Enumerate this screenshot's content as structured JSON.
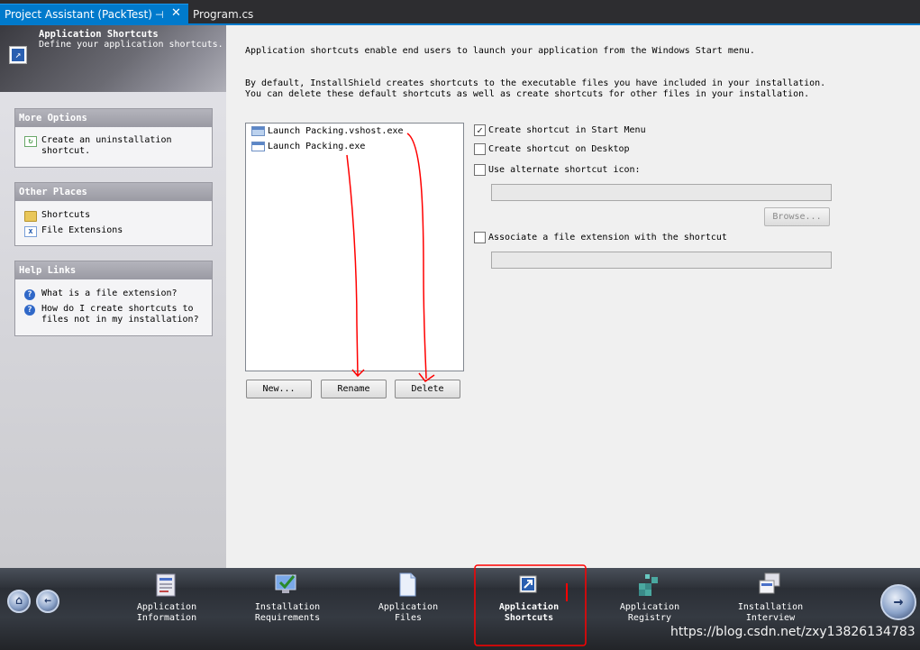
{
  "tabs": [
    {
      "label": "Project Assistant (PackTest)",
      "active": true,
      "pin_icon": "pin-icon",
      "close_icon": "close-icon"
    },
    {
      "label": "Program.cs",
      "active": false
    }
  ],
  "left_panel": {
    "title": "Application Shortcuts",
    "subtitle": "Define your application shortcuts.",
    "more_options": {
      "heading": "More Options",
      "items": [
        {
          "label_line1": "Create an uninstallation",
          "label_line2": "shortcut."
        }
      ]
    },
    "other_places": {
      "heading": "Other Places",
      "items": [
        {
          "label": "Shortcuts"
        },
        {
          "label": "File Extensions"
        }
      ]
    },
    "help_links": {
      "heading": "Help Links",
      "items": [
        {
          "label": "What is a file extension?"
        },
        {
          "label_line1": "How do I create shortcuts to",
          "label_line2": "files not in my installation?"
        }
      ]
    }
  },
  "main": {
    "description1": "Application shortcuts enable end users to launch your application from the Windows Start menu.",
    "description2": "By default, InstallShield creates shortcuts to the executable files you have included in your installation.",
    "description3": "You can delete these default shortcuts as well as create shortcuts for other files in your installation.",
    "shortcuts": [
      {
        "label": "Launch Packing.vshost.exe",
        "selected": true
      },
      {
        "label": "Launch Packing.exe",
        "selected": false
      }
    ],
    "buttons": {
      "new": "New...",
      "rename": "Rename",
      "delete": "Delete",
      "browse": "Browse..."
    },
    "options": {
      "start_menu": {
        "label": "Create shortcut in Start Menu",
        "checked": true
      },
      "desktop": {
        "label": "Create shortcut on Desktop",
        "checked": false
      },
      "alt_icon": {
        "label": "Use alternate shortcut icon:",
        "checked": false
      },
      "file_ext": {
        "label": "Associate a file extension with the shortcut",
        "checked": false
      }
    }
  },
  "bottom_nav": {
    "items": [
      {
        "line1": "Application",
        "line2": "Information",
        "active": false
      },
      {
        "line1": "Installation",
        "line2": "Requirements",
        "active": false
      },
      {
        "line1": "Application",
        "line2": "Files",
        "active": false
      },
      {
        "line1": "Application",
        "line2": "Shortcuts",
        "active": true
      },
      {
        "line1": "Application",
        "line2": "Registry",
        "active": false
      },
      {
        "line1": "Installation",
        "line2": "Interview",
        "active": false
      }
    ],
    "home_icon": "home-icon",
    "back_icon": "back-arrow-icon",
    "next_icon": "next-arrow-icon"
  },
  "watermark": "https://blog.csdn.net/zxy13826134783",
  "colors": {
    "accent": "#007acc",
    "annotation": "#ff0000"
  }
}
